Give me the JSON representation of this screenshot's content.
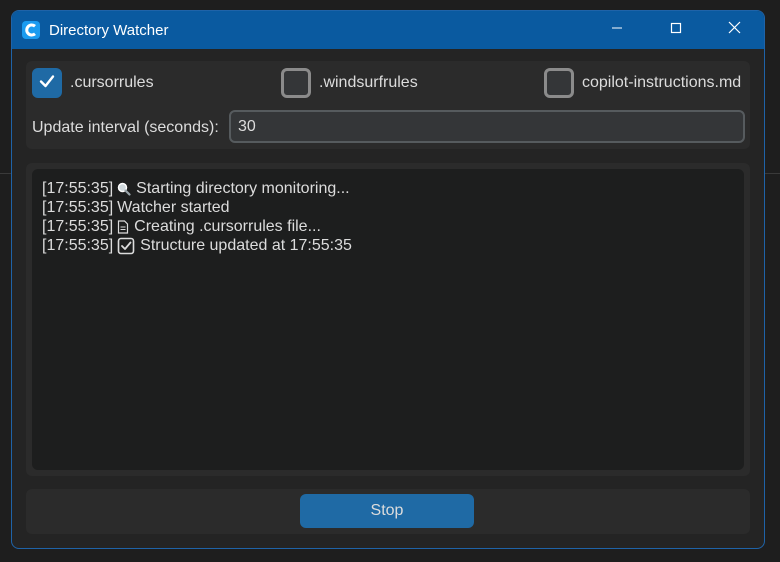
{
  "window": {
    "title": "Directory Watcher",
    "app_icon": "app-c-logo-icon",
    "controls": [
      "minimize-icon",
      "maximize-icon",
      "close-icon"
    ]
  },
  "options": {
    "checkboxes": [
      {
        "label": ".cursorrules",
        "checked": true
      },
      {
        "label": ".windsurfrules",
        "checked": false
      },
      {
        "label": "copilot-instructions.md",
        "checked": false
      }
    ],
    "interval_label": "Update interval (seconds):",
    "interval_value": "30"
  },
  "log": {
    "lines": [
      {
        "time": "[17:55:35]",
        "icon": "magnifier-icon",
        "text": "Starting directory monitoring..."
      },
      {
        "time": "[17:55:35]",
        "icon": "",
        "text": "Watcher started"
      },
      {
        "time": "[17:55:35]",
        "icon": "document-icon",
        "text": "Creating .cursorrules file..."
      },
      {
        "time": "[17:55:35]",
        "icon": "check-box-icon",
        "text": "Structure updated at 17:55:35"
      }
    ]
  },
  "actions": {
    "stop_label": "Stop"
  },
  "colors": {
    "accent": "#1f6aa5",
    "titlebar": "#0a5aa0",
    "panel": "#2b2b2b",
    "log_bg": "#1d1e1e"
  }
}
